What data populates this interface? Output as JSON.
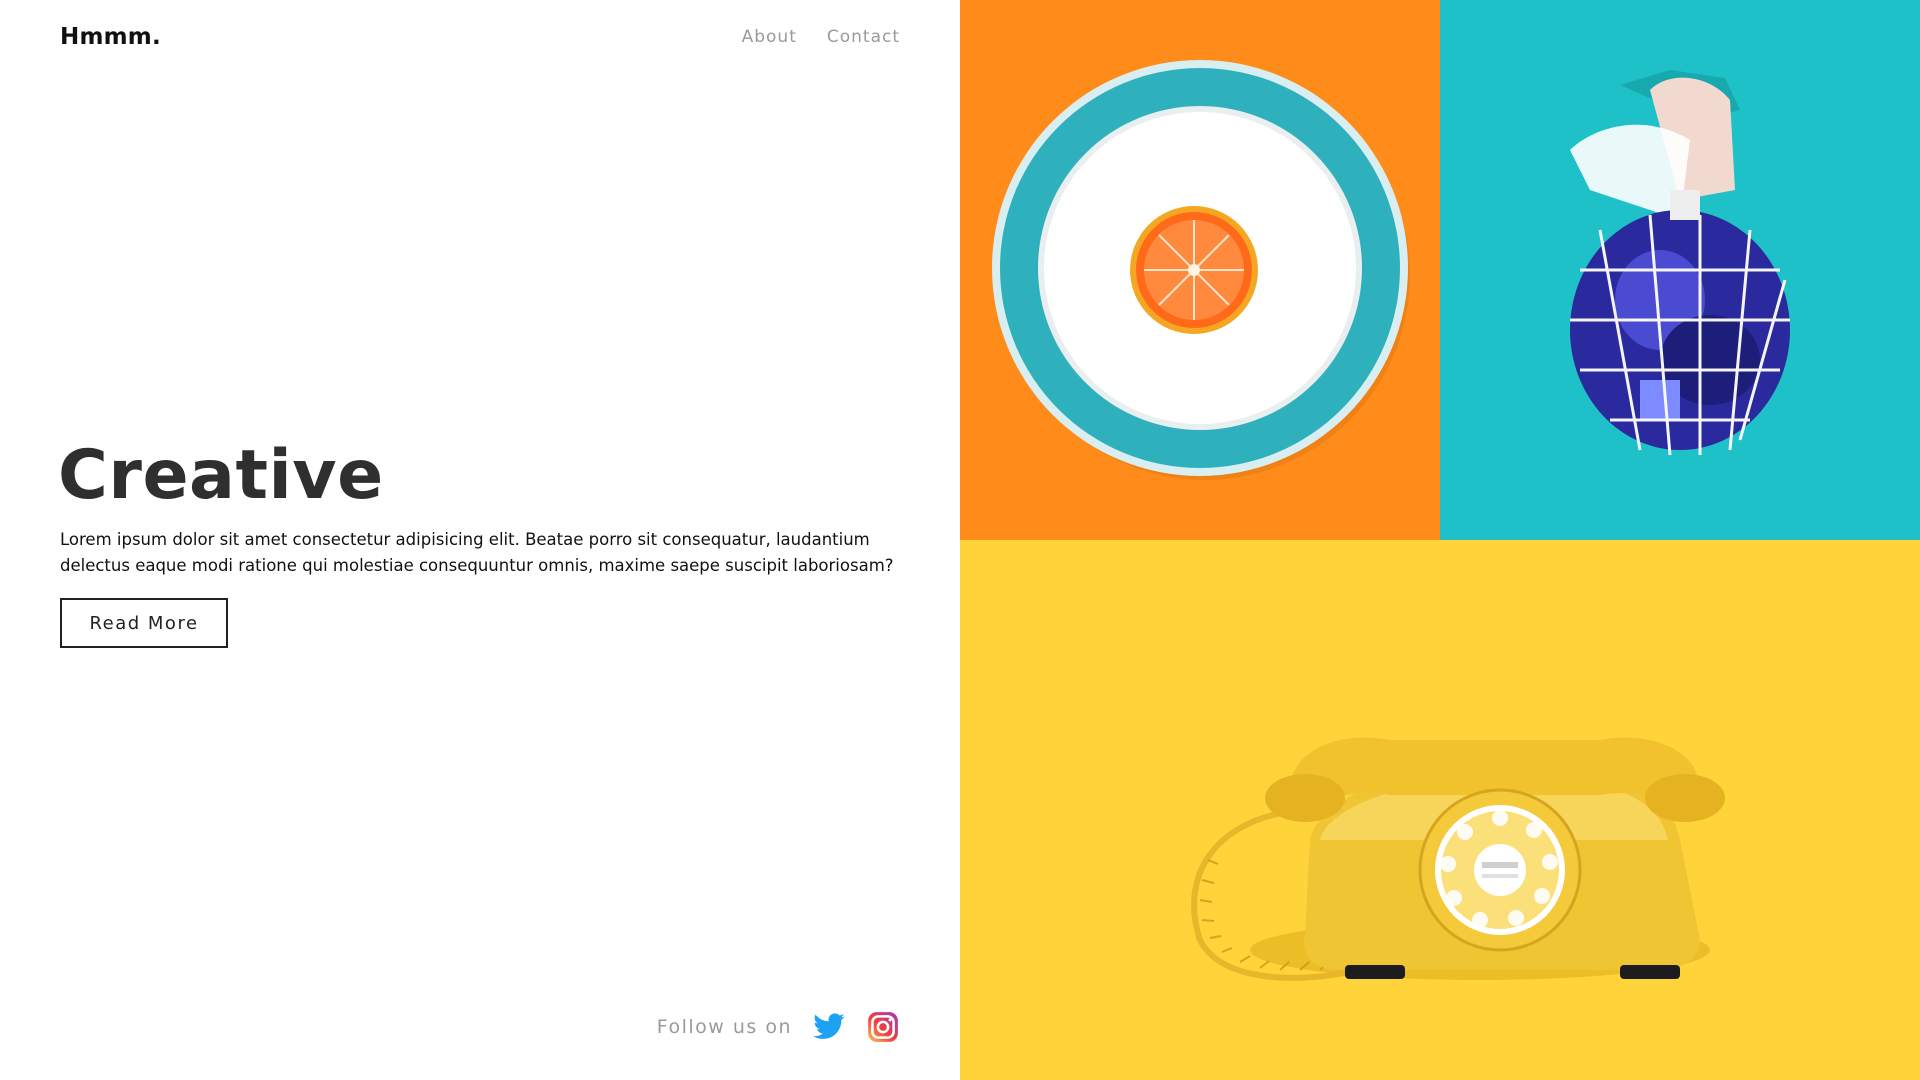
{
  "header": {
    "logo": "Hmmm.",
    "nav": [
      {
        "label": "About"
      },
      {
        "label": "Contact"
      }
    ]
  },
  "hero": {
    "title": "Creative",
    "body": "Lorem ipsum dolor sit amet consectetur adipisicing elit. Beatae porro sit consequatur, laudantium delectus eaque modi ratione qui molestiae consequuntur omnis, maxime saepe suscipit laboriosam?",
    "button_label": "Read More"
  },
  "footer": {
    "follow_label": "Follow us on",
    "social": [
      {
        "icon": "twitter-icon",
        "color": "#1da1f2"
      },
      {
        "icon": "instagram-icon",
        "color": "#e1306c"
      }
    ]
  },
  "gallery": {
    "tiles": [
      {
        "subject": "orange-slice-on-plate",
        "background": "#ff8c1a"
      },
      {
        "subject": "hand-holding-net-bag",
        "background": "#1fc1c8"
      },
      {
        "subject": "yellow-rotary-telephone",
        "background": "#ffd33a"
      }
    ]
  }
}
